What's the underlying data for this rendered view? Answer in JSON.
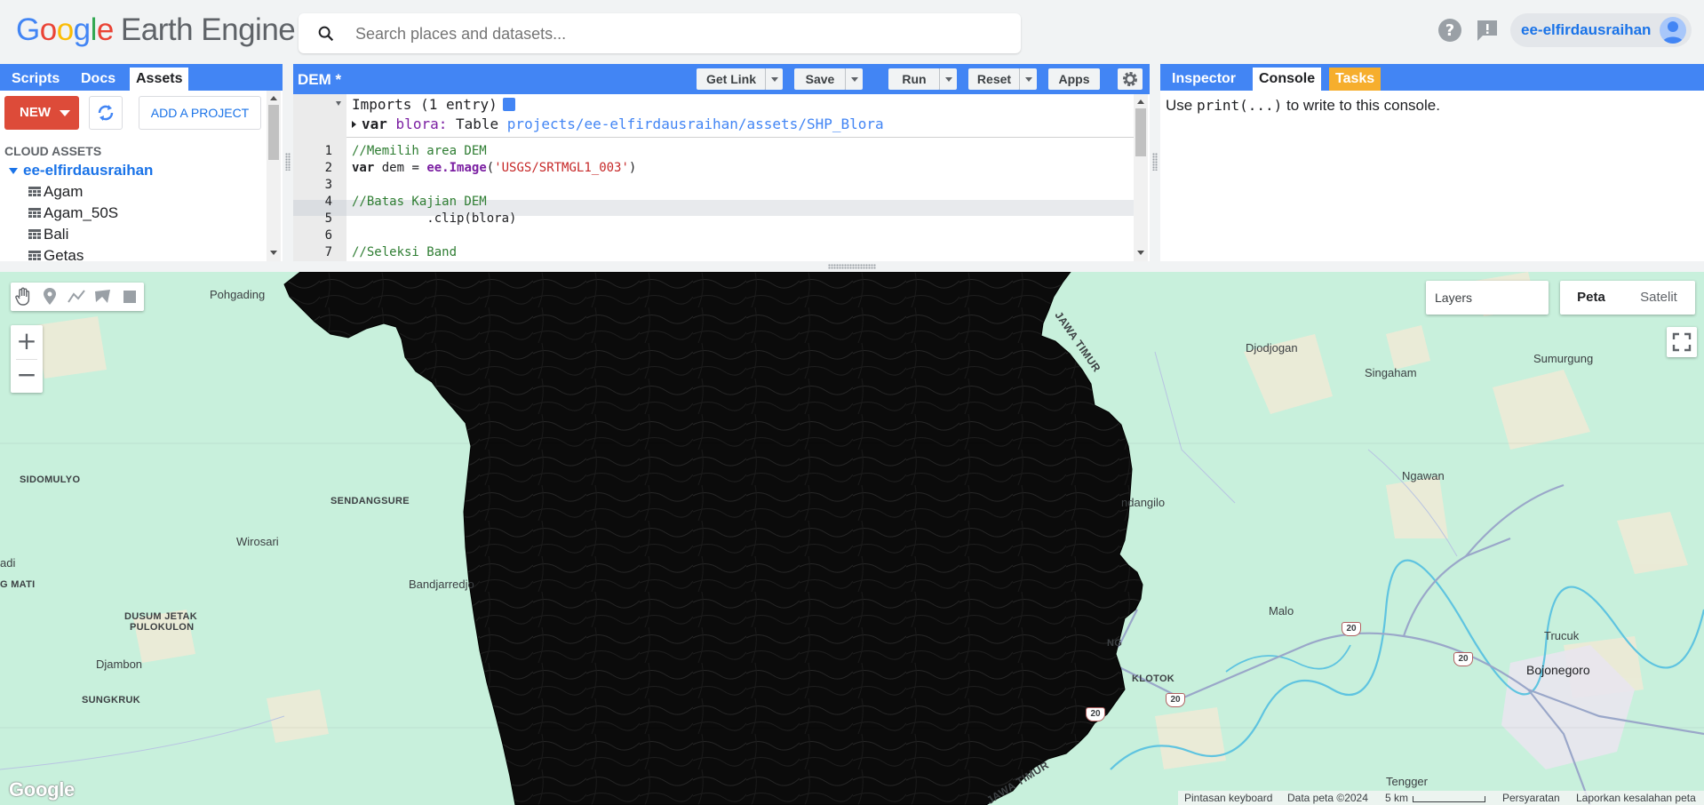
{
  "header": {
    "logo_google": [
      "G",
      "o",
      "o",
      "g",
      "l",
      "e"
    ],
    "logo_product": "Earth Engine",
    "search": {
      "placeholder": "Search places and datasets..."
    },
    "help_icon": "help-icon",
    "feedback_icon": "feedback-icon",
    "account_name": "ee-elfirdausraihan"
  },
  "left_panel": {
    "tabs": [
      {
        "label": "Scripts",
        "active": false
      },
      {
        "label": "Docs",
        "active": false
      },
      {
        "label": "Assets",
        "active": true
      }
    ],
    "new_button": "NEW",
    "add_project_button": "ADD A PROJECT",
    "section_label": "CLOUD ASSETS",
    "project": "ee-elfirdausraihan",
    "assets": [
      "Agam",
      "Agam_50S",
      "Bali",
      "Getas"
    ]
  },
  "editor": {
    "title": "DEM *",
    "buttons": {
      "get_link": "Get Link",
      "save": "Save",
      "run": "Run",
      "reset": "Reset",
      "apps": "Apps"
    },
    "imports_header": "Imports (1 entry)",
    "import": {
      "keyword": "var",
      "name": "blora:",
      "type": "Table",
      "path": "projects/ee-elfirdausraihan/assets/SHP_Blora"
    },
    "lines": [
      {
        "n": "1",
        "text": "//Memilih area DEM"
      },
      {
        "n": "2",
        "kw": "var",
        "plain": " dem = ",
        "obj": "ee.Image",
        "open": "(",
        "str": "'USGS/SRTMGL1_003'",
        "close": ")"
      },
      {
        "n": "3",
        "text": ""
      },
      {
        "n": "4",
        "text": "//Batas Kajian DEM"
      },
      {
        "n": "5",
        "text": "          .clip(blora)"
      },
      {
        "n": "6",
        "text": ""
      },
      {
        "n": "7",
        "text": "//Seleksi Band"
      }
    ],
    "active_line": "5"
  },
  "right_panel": {
    "tabs": [
      {
        "label": "Inspector"
      },
      {
        "label": "Console"
      },
      {
        "label": "Tasks"
      }
    ],
    "console_prefix": "Use ",
    "console_code": "print(...)",
    "console_suffix": " to write to this console."
  },
  "map": {
    "layers_label": "Layers",
    "map_type": {
      "map": "Peta",
      "satellite": "Satelit",
      "selected": "Peta"
    },
    "zoom_in": "+",
    "zoom_out": "−",
    "google_logo": "Google",
    "labels": {
      "pohgading": "Pohgading",
      "sidomulyo": "SIDOMULYO",
      "sendangsure": "SENDANGSURE",
      "wirosari": "Wirosari",
      "adi": "adi",
      "gmati": "G MATI",
      "bandjarredjo": "Bandjarredjo",
      "dusum_jetak": "DUSUM JETAK",
      "pulokulon": "PULOKULON",
      "djambon": "Djambon",
      "sungkruk": "SUNGKRUK",
      "jawa_timur_1": "JAWA TIMUR",
      "jawa_timur_2": "JAWA TIMUR",
      "djodjogan": "Djodjogan",
      "sumurgung": "Sumurgung",
      "singaham": "Singaham",
      "ngawan": "Ngawan",
      "ndangilo": "ndangilo",
      "malo": "Malo",
      "trucuk": "Trucuk",
      "bojonegoro": "Bojonegoro",
      "ng": "NG",
      "klotok": "KLOTOK",
      "tengger": "Tengger"
    },
    "road_shield": "20",
    "attribution": {
      "shortcuts": "Pintasan keyboard",
      "data": "Data peta ©2024",
      "scale": "5 km",
      "terms": "Persyaratan",
      "report": "Laporkan kesalahan peta"
    },
    "colors": {
      "land": "#c8f0dc",
      "dem": "#0a0a0a",
      "river": "#5fc4e0",
      "road": "#9aa7c9",
      "accent": "#4285f4"
    }
  }
}
